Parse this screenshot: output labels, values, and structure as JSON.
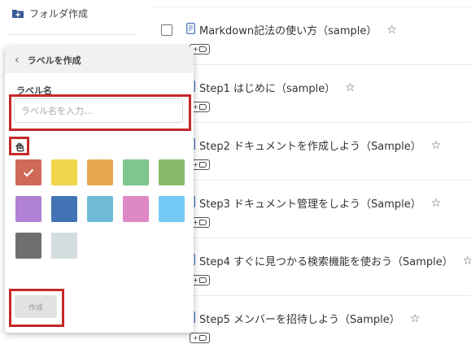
{
  "sidebar": {
    "folder_create_label": "フォルダ作成"
  },
  "documents": [
    {
      "title": "Markdown記法の使い方（sample）",
      "tag_label": "+"
    },
    {
      "title": "Step1 はじめに（sample）",
      "tag_label": "+"
    },
    {
      "title": "Step2 ドキュメントを作成しよう（Sample）",
      "tag_label": "+"
    },
    {
      "title": "Step3 ドキュメント管理をしよう（Sample）",
      "tag_label": "+"
    },
    {
      "title": "Step4 すぐに見つかる検索機能を使おう（Sample）",
      "tag_label": "+"
    },
    {
      "title": "Step5 メンバーを招待しよう（Sample）",
      "tag_label": "+"
    }
  ],
  "popup": {
    "title": "ラベルを作成",
    "back_icon": "chevron-left-icon",
    "name_label": "ラベル名",
    "name_value": "",
    "name_placeholder": "ラベル名を入力...",
    "color_label": "色",
    "selected_color_index": 0,
    "colors": [
      "#cf6a57",
      "#efd54a",
      "#e8a650",
      "#7fc58e",
      "#87b96a",
      "#b081d4",
      "#4273b4",
      "#6fbbd7",
      "#de88c4",
      "#74c9f5",
      "#6f6f6f",
      "#d3dcdf"
    ],
    "create_button": "作成"
  },
  "highlight_color": "#c62828"
}
